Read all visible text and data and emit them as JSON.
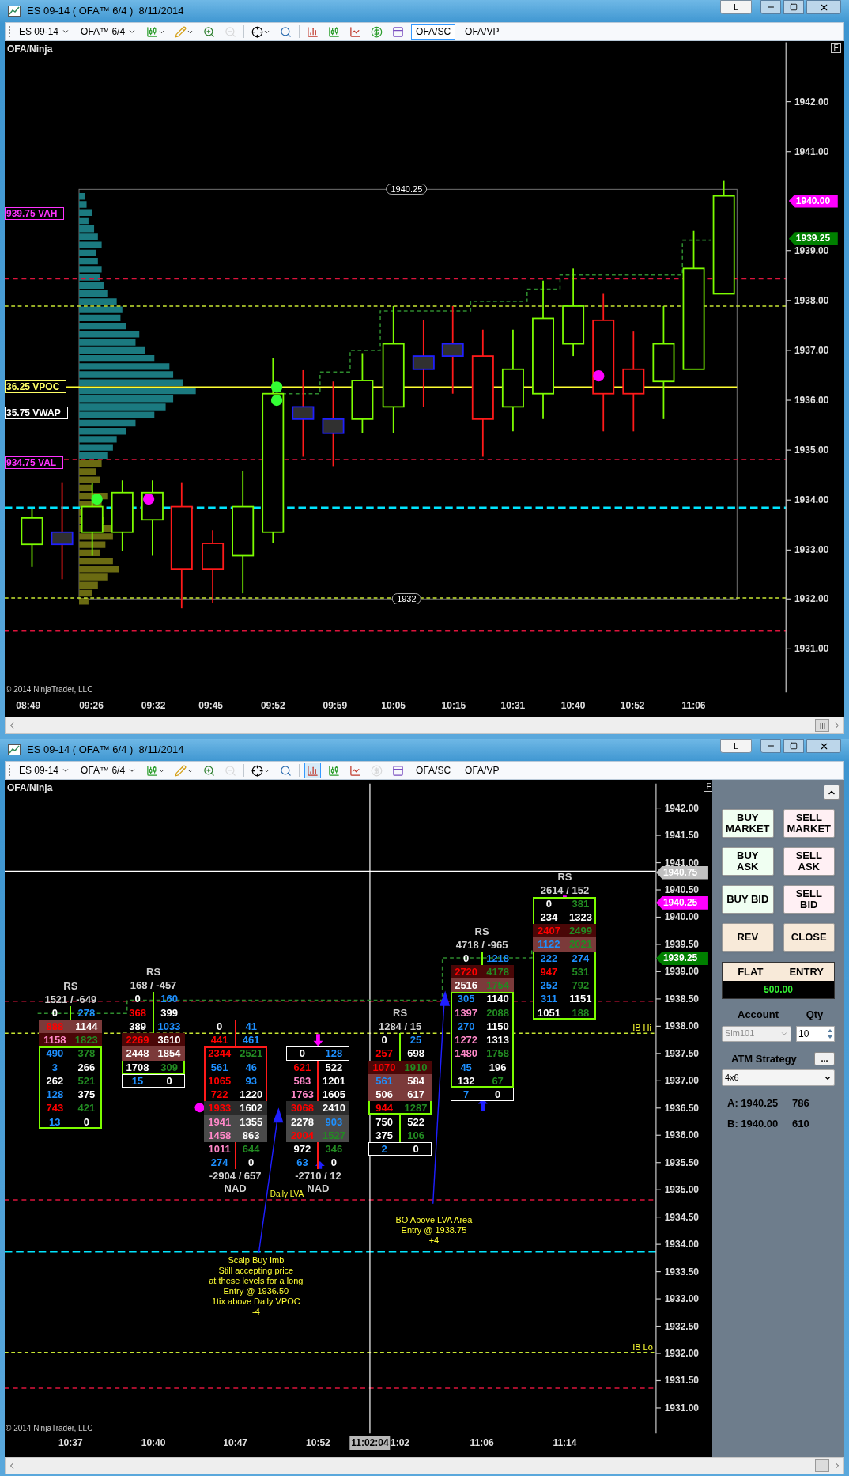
{
  "windows": [
    {
      "title": "ES 09-14 ( OFA™ 6/4 )  8/11/2014",
      "title_buttons": [
        "L"
      ],
      "toolbar": {
        "instrument": "ES 09-14",
        "template": "OFA™ 6/4",
        "tools": [
          {
            "kind": "bars",
            "selected": false,
            "disabled": false
          },
          {
            "kind": "pencil",
            "selected": false,
            "disabled": false
          },
          {
            "kind": "zoom_in",
            "selected": false,
            "disabled": false
          },
          {
            "kind": "zoom_out",
            "selected": false,
            "disabled": true
          },
          {
            "kind": "crosshair",
            "selected": false,
            "disabled": false
          },
          {
            "kind": "find",
            "selected": false,
            "disabled": false
          },
          {
            "kind": "bar_style",
            "selected": false,
            "disabled": false
          },
          {
            "kind": "chart_style",
            "selected": false,
            "disabled": false
          },
          {
            "kind": "area",
            "selected": false,
            "disabled": false
          },
          {
            "kind": "dollar",
            "selected": false,
            "disabled": false
          },
          {
            "kind": "panel",
            "selected": false,
            "disabled": false
          }
        ],
        "views": [
          {
            "label": "OFA/SC",
            "selected": true
          },
          {
            "label": "OFA/VP",
            "selected": false
          }
        ]
      },
      "chart": {
        "kind": "candles",
        "name": "OFA/Ninja",
        "flag": "F",
        "price_labels": [
          "1942.00",
          "1941.00",
          "1939.00",
          "1938.00",
          "1937.00",
          "1936.00",
          "1935.00",
          "1934.00",
          "1933.00",
          "1932.00",
          "1931.00"
        ],
        "price_flags": [
          {
            "text": "1940.00",
            "color": "#ff00ff"
          },
          {
            "text": "1939.25",
            "color": "#008000"
          }
        ],
        "level_labels": [
          {
            "text": "939.75 VAH",
            "color": "#ff33ff"
          },
          {
            "text": "36.25 VPOC",
            "color": "#ffff66"
          },
          {
            "text": "35.75 VWAP",
            "color": "#ffffff"
          },
          {
            "text": "934.75 VAL",
            "color": "#ff33ff"
          }
        ],
        "range_labels": [
          "1940.25",
          "1932"
        ],
        "time_labels": [
          "08:49",
          "09:26",
          "09:32",
          "09:45",
          "09:52",
          "09:59",
          "10:05",
          "10:15",
          "10:31",
          "10:40",
          "10:52",
          "11:06"
        ],
        "copyright": "© 2014 NinjaTrader, LLC"
      }
    },
    {
      "title": "ES 09-14 ( OFA™ 6/4 )  8/11/2014",
      "title_buttons": [
        "L"
      ],
      "toolbar": {
        "instrument": "ES 09-14",
        "template": "OFA™ 6/4",
        "tools": [
          {
            "kind": "bars",
            "selected": false,
            "disabled": false
          },
          {
            "kind": "pencil",
            "selected": false,
            "disabled": false
          },
          {
            "kind": "zoom_in",
            "selected": false,
            "disabled": false
          },
          {
            "kind": "zoom_out",
            "selected": false,
            "disabled": true
          },
          {
            "kind": "crosshair",
            "selected": false,
            "disabled": false
          },
          {
            "kind": "find",
            "selected": false,
            "disabled": false
          },
          {
            "kind": "bar_style",
            "selected": true,
            "disabled": false
          },
          {
            "kind": "chart_style",
            "selected": false,
            "disabled": false
          },
          {
            "kind": "area",
            "selected": false,
            "disabled": false
          },
          {
            "kind": "dollar",
            "selected": false,
            "disabled": true
          },
          {
            "kind": "panel",
            "selected": false,
            "disabled": false
          }
        ],
        "views": [
          {
            "label": "OFA/SC",
            "selected": false
          },
          {
            "label": "OFA/VP",
            "selected": false
          }
        ]
      },
      "chart": {
        "kind": "footprint",
        "name": "OFA/Ninja",
        "flag": "F",
        "price_labels": [
          "1942.00",
          "1941.50",
          "1941.00",
          "1940.50",
          "1940.00",
          "1939.50",
          "1939.00",
          "1938.50",
          "1938.00",
          "1937.50",
          "1937.00",
          "1936.50",
          "1936.00",
          "1935.50",
          "1935.00",
          "1934.50",
          "1934.00",
          "1933.50",
          "1933.00",
          "1932.50",
          "1932.00",
          "1931.50",
          "1931.00"
        ],
        "price_flags": [
          {
            "text": "1940.75",
            "color": "#c0c0c0"
          },
          {
            "text": "1940.25",
            "color": "#ff00ff"
          },
          {
            "text": "1939.25",
            "color": "#008000"
          }
        ],
        "bars": [
          {
            "top_label": "RS",
            "top_summary": "1521 / -649",
            "color": "#7cfc00",
            "rows": [
              {
                "kind": "plain",
                "cells": [
                  {
                    "text": "0",
                    "color": "#ffffff"
                  },
                  {
                    "text": "278",
                    "color": "#1e90ff"
                  }
                ]
              },
              {
                "kind": "plain",
                "color": "#7b3a3a",
                "cells": [
                  {
                    "text": "888",
                    "color": "#ff0000"
                  },
                  {
                    "text": "1144",
                    "color": "#ffffff"
                  }
                ]
              },
              {
                "kind": "plain",
                "color": "#4a0707",
                "cells": [
                  {
                    "text": "1158",
                    "color": "#ff88c8"
                  },
                  {
                    "text": "1823",
                    "color": "#228b22"
                  }
                ]
              },
              {
                "kind": "body",
                "cells": [
                  {
                    "text": "490",
                    "color": "#1e90ff"
                  },
                  {
                    "text": "378",
                    "color": "#228b22"
                  }
                ]
              },
              {
                "kind": "body",
                "cells": [
                  {
                    "text": "3",
                    "color": "#1e90ff"
                  },
                  {
                    "text": "266",
                    "color": "#ffffff"
                  }
                ]
              },
              {
                "kind": "body",
                "cells": [
                  {
                    "text": "262",
                    "color": "#ffffff"
                  },
                  {
                    "text": "521",
                    "color": "#228b22"
                  }
                ]
              },
              {
                "kind": "body",
                "cells": [
                  {
                    "text": "128",
                    "color": "#1e90ff"
                  },
                  {
                    "text": "375",
                    "color": "#ffffff"
                  }
                ]
              },
              {
                "kind": "body",
                "cells": [
                  {
                    "text": "743",
                    "color": "#ff0000"
                  },
                  {
                    "text": "421",
                    "color": "#228b22"
                  }
                ]
              },
              {
                "kind": "body",
                "cells": [
                  {
                    "text": "13",
                    "color": "#1e90ff"
                  },
                  {
                    "text": "0",
                    "color": "#ffffff"
                  }
                ]
              }
            ]
          },
          {
            "top_label": "RS",
            "top_summary": "168 / -457",
            "color": "#7cfc00",
            "rows": [
              {
                "kind": "plain",
                "cells": [
                  {
                    "text": "0",
                    "color": "#ffffff"
                  },
                  {
                    "text": "160",
                    "color": "#1e90ff"
                  }
                ]
              },
              {
                "kind": "plain",
                "cells": [
                  {
                    "text": "368",
                    "color": "#ff0000"
                  },
                  {
                    "text": "399",
                    "color": "#ffffff"
                  }
                ]
              },
              {
                "kind": "plain",
                "cells": [
                  {
                    "text": "389",
                    "color": "#ffffff"
                  },
                  {
                    "text": "1033",
                    "color": "#1e90ff"
                  }
                ]
              },
              {
                "kind": "body",
                "color": "#4a0707",
                "cells": [
                  {
                    "text": "2269",
                    "color": "#ff0000"
                  },
                  {
                    "text": "3610",
                    "color": "#ffffff"
                  }
                ]
              },
              {
                "kind": "body",
                "color": "#7b3a3a",
                "cells": [
                  {
                    "text": "2448",
                    "color": "#ffffff"
                  },
                  {
                    "text": "1854",
                    "color": "#ffffff"
                  }
                ]
              },
              {
                "kind": "body",
                "cells": [
                  {
                    "text": "1708",
                    "color": "#ffffff"
                  },
                  {
                    "text": "309",
                    "color": "#228b22"
                  }
                ]
              },
              {
                "kind": "edge",
                "cells": [
                  {
                    "text": "15",
                    "color": "#1e90ff"
                  },
                  {
                    "text": "0",
                    "color": "#ffffff"
                  }
                ]
              }
            ]
          },
          {
            "bottom_summary": "-2904 / 657",
            "bottom_label": "NAD",
            "color": "#ff1a1a",
            "rows": [
              {
                "kind": "plain",
                "cells": [
                  {
                    "text": "0",
                    "color": "#ffffff"
                  },
                  {
                    "text": "41",
                    "color": "#1e90ff"
                  }
                ]
              },
              {
                "kind": "plain",
                "cells": [
                  {
                    "text": "441",
                    "color": "#ff0000"
                  },
                  {
                    "text": "461",
                    "color": "#1e90ff"
                  }
                ]
              },
              {
                "kind": "body",
                "cells": [
                  {
                    "text": "2344",
                    "color": "#ff0000"
                  },
                  {
                    "text": "2521",
                    "color": "#228b22"
                  }
                ]
              },
              {
                "kind": "body",
                "cells": [
                  {
                    "text": "561",
                    "color": "#1e90ff"
                  },
                  {
                    "text": "46",
                    "color": "#1e90ff"
                  }
                ]
              },
              {
                "kind": "body",
                "cells": [
                  {
                    "text": "1065",
                    "color": "#ff0000"
                  },
                  {
                    "text": "93",
                    "color": "#1e90ff"
                  }
                ]
              },
              {
                "kind": "body",
                "cells": [
                  {
                    "text": "722",
                    "color": "#ff0000"
                  },
                  {
                    "text": "1220",
                    "color": "#ffffff"
                  }
                ]
              },
              {
                "kind": "body",
                "color": "#2b2b2b",
                "cells": [
                  {
                    "text": "1933",
                    "color": "#ff0000"
                  },
                  {
                    "text": "1602",
                    "color": "#ffffff"
                  }
                ]
              },
              {
                "kind": "body",
                "color": "#4a4a4a",
                "cells": [
                  {
                    "text": "1941",
                    "color": "#ff88c8"
                  },
                  {
                    "text": "1355",
                    "color": "#ffffff"
                  }
                ]
              },
              {
                "kind": "plain",
                "color": "#4a4a4a",
                "cells": [
                  {
                    "text": "1458",
                    "color": "#ff88c8"
                  },
                  {
                    "text": "863",
                    "color": "#ffffff"
                  }
                ]
              },
              {
                "kind": "plain",
                "cells": [
                  {
                    "text": "1011",
                    "color": "#ff88c8"
                  },
                  {
                    "text": "644",
                    "color": "#228b22"
                  }
                ]
              },
              {
                "kind": "plain",
                "cells": [
                  {
                    "text": "274",
                    "color": "#1e90ff"
                  },
                  {
                    "text": "0",
                    "color": "#ffffff"
                  }
                ]
              }
            ]
          },
          {
            "bottom_summary": "-2710 / 12",
            "bottom_label": "NAD",
            "color": "#ff1a1a",
            "rows": [
              {
                "kind": "edge",
                "cells": [
                  {
                    "text": "0",
                    "color": "#ffffff"
                  },
                  {
                    "text": "128",
                    "color": "#1e90ff"
                  }
                ]
              },
              {
                "kind": "plain",
                "cells": [
                  {
                    "text": "621",
                    "color": "#ff0000"
                  },
                  {
                    "text": "522",
                    "color": "#ffffff"
                  }
                ]
              },
              {
                "kind": "plain",
                "cells": [
                  {
                    "text": "583",
                    "color": "#ff88c8"
                  },
                  {
                    "text": "1201",
                    "color": "#ffffff"
                  }
                ]
              },
              {
                "kind": "plain",
                "cells": [
                  {
                    "text": "1763",
                    "color": "#ff88c8"
                  },
                  {
                    "text": "1605",
                    "color": "#ffffff"
                  }
                ]
              },
              {
                "kind": "body",
                "color": "#2b2b2b",
                "cells": [
                  {
                    "text": "3068",
                    "color": "#ff0000"
                  },
                  {
                    "text": "2410",
                    "color": "#ffffff"
                  }
                ]
              },
              {
                "kind": "body",
                "color": "#4a4a4a",
                "cells": [
                  {
                    "text": "2278",
                    "color": "#ffffff"
                  },
                  {
                    "text": "903",
                    "color": "#1e90ff"
                  }
                ]
              },
              {
                "kind": "plain",
                "color": "#4a4a4a",
                "cells": [
                  {
                    "text": "2004",
                    "color": "#ff0000"
                  },
                  {
                    "text": "1527",
                    "color": "#228b22"
                  }
                ]
              },
              {
                "kind": "plain",
                "cells": [
                  {
                    "text": "972",
                    "color": "#ffffff"
                  },
                  {
                    "text": "346",
                    "color": "#228b22"
                  }
                ]
              },
              {
                "kind": "plain",
                "cells": [
                  {
                    "text": "63",
                    "color": "#1e90ff"
                  },
                  {
                    "text": "0",
                    "color": "#ffffff"
                  }
                ]
              }
            ]
          },
          {
            "top_label": "RS",
            "top_summary": "1284 / 15",
            "color": "#7cfc00",
            "rows": [
              {
                "kind": "plain",
                "cells": [
                  {
                    "text": "0",
                    "color": "#ffffff"
                  },
                  {
                    "text": "25",
                    "color": "#1e90ff"
                  }
                ]
              },
              {
                "kind": "plain",
                "cells": [
                  {
                    "text": "257",
                    "color": "#ff0000"
                  },
                  {
                    "text": "698",
                    "color": "#ffffff"
                  }
                ]
              },
              {
                "kind": "plain",
                "color": "#4a0707",
                "cells": [
                  {
                    "text": "1070",
                    "color": "#ff0000"
                  },
                  {
                    "text": "1910",
                    "color": "#228b22"
                  }
                ]
              },
              {
                "kind": "body",
                "color": "#7b3a3a",
                "cells": [
                  {
                    "text": "561",
                    "color": "#1e90ff"
                  },
                  {
                    "text": "584",
                    "color": "#ffffff"
                  }
                ]
              },
              {
                "kind": "body",
                "color": "#7b3a3a",
                "cells": [
                  {
                    "text": "506",
                    "color": "#ffffff"
                  },
                  {
                    "text": "617",
                    "color": "#ffffff"
                  }
                ]
              },
              {
                "kind": "body",
                "cells": [
                  {
                    "text": "944",
                    "color": "#ff0000"
                  },
                  {
                    "text": "1287",
                    "color": "#228b22"
                  }
                ]
              },
              {
                "kind": "plain",
                "cells": [
                  {
                    "text": "750",
                    "color": "#ffffff"
                  },
                  {
                    "text": "522",
                    "color": "#ffffff"
                  }
                ]
              },
              {
                "kind": "plain",
                "cells": [
                  {
                    "text": "375",
                    "color": "#ffffff"
                  },
                  {
                    "text": "106",
                    "color": "#228b22"
                  }
                ]
              },
              {
                "kind": "edge",
                "cells": [
                  {
                    "text": "2",
                    "color": "#1e90ff"
                  },
                  {
                    "text": "0",
                    "color": "#ffffff"
                  }
                ]
              }
            ]
          },
          {
            "top_label": "RS",
            "top_summary": "4718 / -965",
            "color": "#7cfc00",
            "rows": [
              {
                "kind": "plain",
                "cells": [
                  {
                    "text": "0",
                    "color": "#ffffff"
                  },
                  {
                    "text": "1218",
                    "color": "#1e90ff"
                  }
                ]
              },
              {
                "kind": "plain",
                "color": "#4a0707",
                "cells": [
                  {
                    "text": "2720",
                    "color": "#ff0000"
                  },
                  {
                    "text": "4178",
                    "color": "#228b22"
                  }
                ]
              },
              {
                "kind": "plain",
                "color": "#7b3a3a",
                "cells": [
                  {
                    "text": "2516",
                    "color": "#ffffff"
                  },
                  {
                    "text": "1754",
                    "color": "#228b22"
                  }
                ]
              },
              {
                "kind": "body",
                "cells": [
                  {
                    "text": "305",
                    "color": "#1e90ff"
                  },
                  {
                    "text": "1140",
                    "color": "#ffffff"
                  }
                ]
              },
              {
                "kind": "body",
                "cells": [
                  {
                    "text": "1397",
                    "color": "#ff88c8"
                  },
                  {
                    "text": "2088",
                    "color": "#228b22"
                  }
                ]
              },
              {
                "kind": "body",
                "cells": [
                  {
                    "text": "270",
                    "color": "#1e90ff"
                  },
                  {
                    "text": "1150",
                    "color": "#ffffff"
                  }
                ]
              },
              {
                "kind": "body",
                "cells": [
                  {
                    "text": "1272",
                    "color": "#ff88c8"
                  },
                  {
                    "text": "1313",
                    "color": "#ffffff"
                  }
                ]
              },
              {
                "kind": "body",
                "cells": [
                  {
                    "text": "1480",
                    "color": "#ff88c8"
                  },
                  {
                    "text": "1758",
                    "color": "#228b22"
                  }
                ]
              },
              {
                "kind": "body",
                "cells": [
                  {
                    "text": "45",
                    "color": "#1e90ff"
                  },
                  {
                    "text": "196",
                    "color": "#ffffff"
                  }
                ]
              },
              {
                "kind": "body",
                "cells": [
                  {
                    "text": "132",
                    "color": "#ffffff"
                  },
                  {
                    "text": "67",
                    "color": "#228b22"
                  }
                ]
              },
              {
                "kind": "edge",
                "cells": [
                  {
                    "text": "7",
                    "color": "#1e90ff"
                  },
                  {
                    "text": "0",
                    "color": "#ffffff"
                  }
                ]
              }
            ]
          },
          {
            "top_label": "RS",
            "top_summary": "2614 / 152",
            "color": "#7cfc00",
            "rows": [
              {
                "kind": "body",
                "cells": [
                  {
                    "text": "0",
                    "color": "#ffffff"
                  },
                  {
                    "text": "381",
                    "color": "#228b22"
                  }
                ]
              },
              {
                "kind": "body",
                "cells": [
                  {
                    "text": "234",
                    "color": "#ffffff"
                  },
                  {
                    "text": "1323",
                    "color": "#ffffff"
                  }
                ]
              },
              {
                "kind": "body",
                "color": "#4a0707",
                "cells": [
                  {
                    "text": "2407",
                    "color": "#ff0000"
                  },
                  {
                    "text": "2499",
                    "color": "#228b22"
                  }
                ]
              },
              {
                "kind": "body",
                "color": "#7b3a3a",
                "cells": [
                  {
                    "text": "1122",
                    "color": "#1e90ff"
                  },
                  {
                    "text": "2021",
                    "color": "#228b22"
                  }
                ]
              },
              {
                "kind": "body",
                "cells": [
                  {
                    "text": "222",
                    "color": "#1e90ff"
                  },
                  {
                    "text": "274",
                    "color": "#1e90ff"
                  }
                ]
              },
              {
                "kind": "body",
                "cells": [
                  {
                    "text": "947",
                    "color": "#ff0000"
                  },
                  {
                    "text": "531",
                    "color": "#228b22"
                  }
                ]
              },
              {
                "kind": "body",
                "cells": [
                  {
                    "text": "252",
                    "color": "#1e90ff"
                  },
                  {
                    "text": "792",
                    "color": "#228b22"
                  }
                ]
              },
              {
                "kind": "body",
                "cells": [
                  {
                    "text": "311",
                    "color": "#1e90ff"
                  },
                  {
                    "text": "1151",
                    "color": "#ffffff"
                  }
                ]
              },
              {
                "kind": "body",
                "cells": [
                  {
                    "text": "1051",
                    "color": "#ffffff"
                  },
                  {
                    "text": "188",
                    "color": "#228b22"
                  }
                ]
              }
            ]
          }
        ],
        "level_tags": [
          "IB Hi",
          "IB Lo"
        ],
        "lva_label": "Daily LVA",
        "notes": [
          {
            "lines": [
              "Scalp Buy Imb",
              "Still accepting price",
              "at these levels for a long",
              "Entry @ 1936.50",
              "1tix above Daily VPOC",
              "-4"
            ]
          },
          {
            "lines": [
              "BO Above LVA Area",
              "Entry @ 1938.75",
              "+4"
            ]
          }
        ],
        "time_labels": [
          "10:37",
          "10:40",
          "10:47",
          "10:52",
          "1:02",
          "11:06",
          "11:14"
        ],
        "cursor_time": "11:02:04",
        "copyright": "© 2014 NinjaTrader, LLC"
      },
      "order_panel": {
        "buttons": [
          {
            "kind": "buy",
            "lines": [
              "BUY",
              "MARKET"
            ]
          },
          {
            "kind": "sell",
            "lines": [
              "SELL",
              "MARKET"
            ]
          },
          {
            "kind": "buy",
            "lines": [
              "BUY",
              "ASK"
            ]
          },
          {
            "kind": "sell",
            "lines": [
              "SELL",
              "ASK"
            ]
          },
          {
            "kind": "buy",
            "lines": [
              "BUY BID"
            ]
          },
          {
            "kind": "sell",
            "lines": [
              "SELL",
              "BID"
            ]
          },
          {
            "kind": "neutral",
            "lines": [
              "REV"
            ]
          },
          {
            "kind": "neutral",
            "lines": [
              "CLOSE"
            ]
          }
        ],
        "position": {
          "columns": [
            "FLAT",
            "ENTRY"
          ],
          "value": "500.00"
        },
        "account": {
          "label": "Account",
          "value": "Sim101",
          "disabled": true
        },
        "quantity": {
          "label": "Qty",
          "value": "10"
        },
        "atm": {
          "label": "ATM Strategy",
          "button": "...",
          "value": "4x6"
        },
        "quotes": [
          {
            "label": "A: 1940.25",
            "size": "786"
          },
          {
            "label": "B: 1940.00",
            "size": "610"
          }
        ]
      }
    }
  ]
}
